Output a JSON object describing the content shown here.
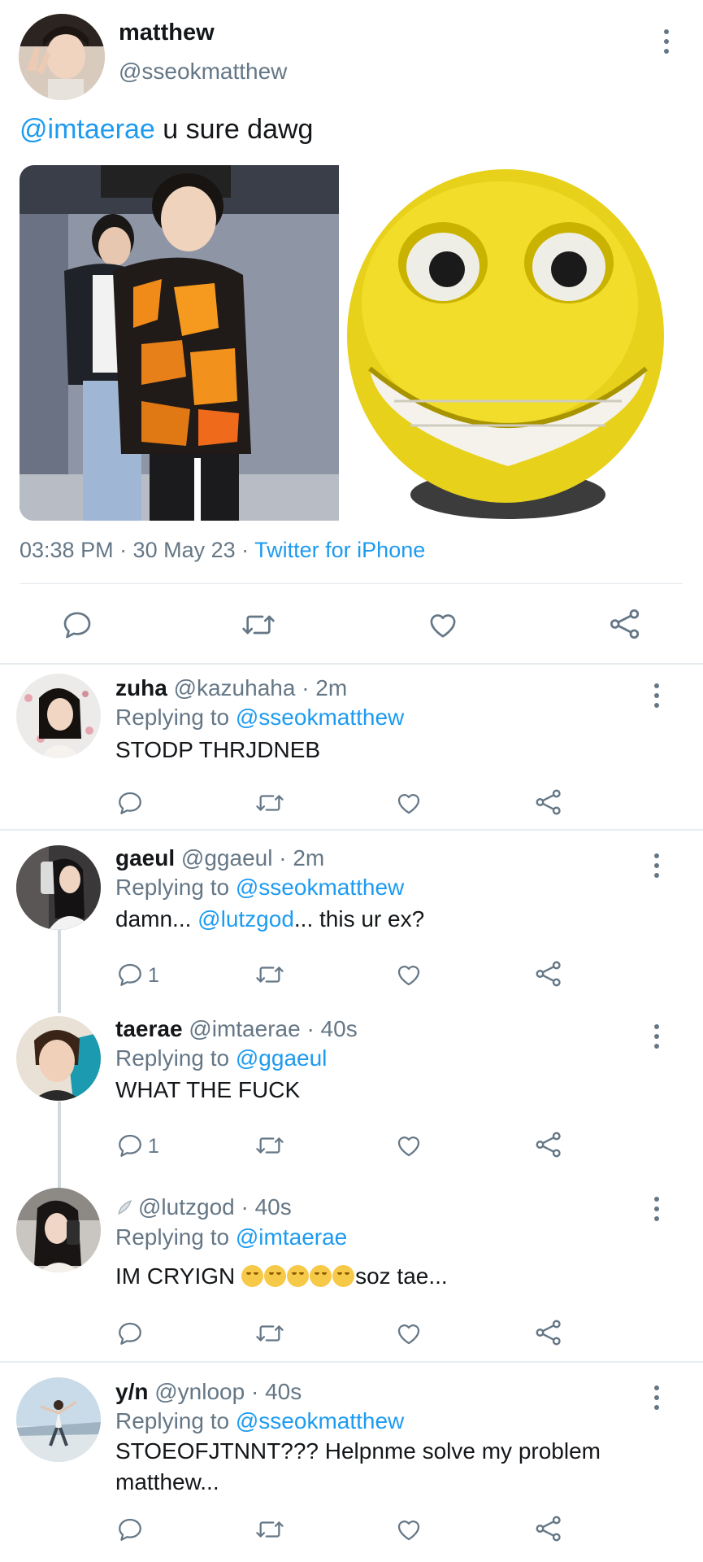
{
  "main_tweet": {
    "author_name": "matthew",
    "author_handle": "@sseokmatthew",
    "text_mention": "@imtaerae",
    "text_body": " u sure dawg",
    "meta_time": "03:38 PM · 30 May 23 · ",
    "meta_source": "Twitter for iPhone",
    "actions": [
      "reply-icon",
      "retweet-icon",
      "like-icon",
      "share-icon"
    ]
  },
  "replies": [
    {
      "name": "zuha",
      "handle": "@kazuhaha",
      "time": " · 2m",
      "replying_prefix": "Replying to ",
      "replying_to": "@sseokmatthew",
      "text": "STODP THRJDNEB",
      "reply_count": ""
    },
    {
      "name": "gaeul",
      "handle": "@ggaeul",
      "time": " · 2m",
      "replying_prefix": "Replying to ",
      "replying_to": "@sseokmatthew",
      "text_before": "damn... ",
      "text_mention": "@lutzgod",
      "text_after": "... this ur ex?",
      "reply_count": "1"
    },
    {
      "name": "taerae",
      "handle": "@imtaerae",
      "time": " · 40s",
      "replying_prefix": "Replying to ",
      "replying_to": "@ggaeul",
      "text": "WHAT THE FUCK",
      "reply_count": "1"
    },
    {
      "name": "",
      "handle": "@lutzgod",
      "time": " · 40s",
      "replying_prefix": "Replying to ",
      "replying_to": "@imtaerae",
      "text_before": "IM CRYIGN ",
      "text_after": "soz tae...",
      "emoji_count": 5,
      "reply_count": ""
    },
    {
      "name": "y/n",
      "handle": "@ynloop",
      "time": " · 40s",
      "replying_prefix": "Replying to ",
      "replying_to": "@sseokmatthew",
      "text": "STOEOFJTNNT??? Helpnme solve my problem matthew...",
      "reply_count": ""
    }
  ],
  "colors": {
    "link": "#1d9bf0",
    "muted": "#657786",
    "divider": "#e6ecf0"
  }
}
